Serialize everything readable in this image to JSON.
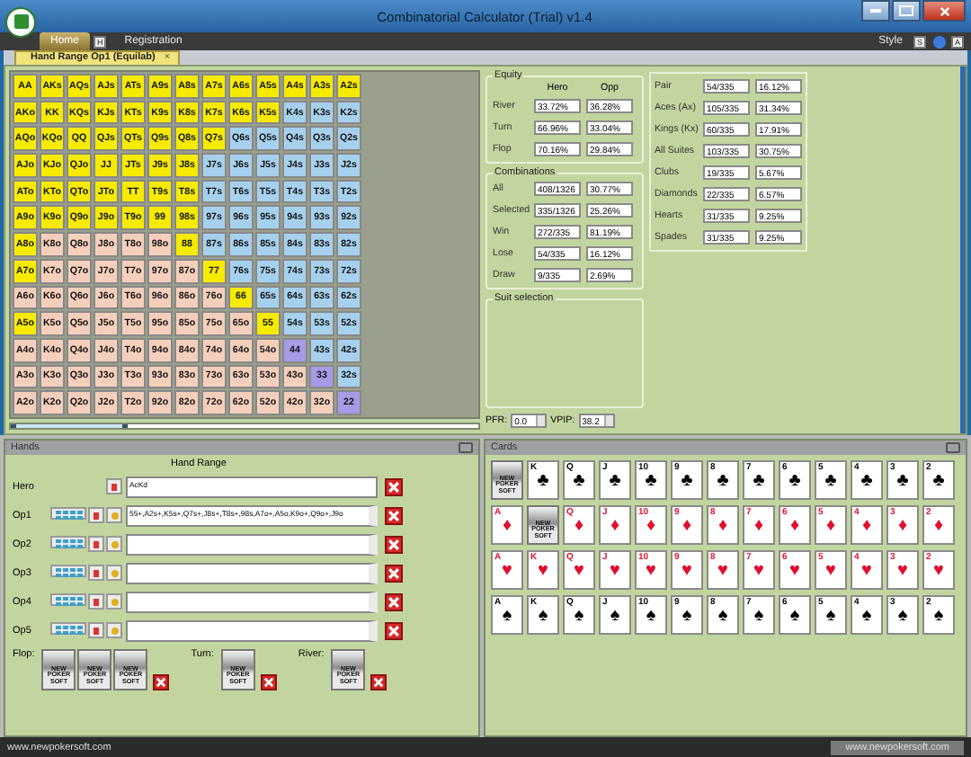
{
  "window": {
    "title": "Combinatorial Calculator (Trial) v1.4"
  },
  "ribbon": {
    "tabs": [
      {
        "label": "Home",
        "selected": true,
        "keytip": "H"
      },
      {
        "label": "Registration",
        "selected": false
      }
    ],
    "style_label": "Style",
    "style_keytip": "S",
    "help_keytip": "A"
  },
  "document_tab": {
    "label": "Hand Range Op1 (Equilab)",
    "close": "×"
  },
  "range_grid": {
    "rows": [
      {
        "cells": [
          {
            "label": "AA",
            "selected": true
          },
          {
            "label": "AKs",
            "selected": true
          },
          {
            "label": "AQs",
            "selected": true
          },
          {
            "label": "AJs",
            "selected": true
          },
          {
            "label": "ATs",
            "selected": true
          },
          {
            "label": "A9s",
            "selected": true
          },
          {
            "label": "A8s",
            "selected": true
          },
          {
            "label": "A7s",
            "selected": true
          },
          {
            "label": "A6s",
            "selected": true
          },
          {
            "label": "A5s",
            "selected": true
          },
          {
            "label": "A4s",
            "selected": true
          },
          {
            "label": "A3s",
            "selected": true
          },
          {
            "label": "A2s",
            "selected": true
          }
        ]
      },
      {
        "cells": [
          {
            "label": "AKo",
            "selected": true
          },
          {
            "label": "KK",
            "selected": true
          },
          {
            "label": "KQs",
            "selected": true
          },
          {
            "label": "KJs",
            "selected": true
          },
          {
            "label": "KTs",
            "selected": true
          },
          {
            "label": "K9s",
            "selected": true
          },
          {
            "label": "K8s",
            "selected": true
          },
          {
            "label": "K7s",
            "selected": true
          },
          {
            "label": "K6s",
            "selected": true
          },
          {
            "label": "K5s",
            "selected": true
          },
          {
            "label": "K4s",
            "selected": false
          },
          {
            "label": "K3s",
            "selected": false
          },
          {
            "label": "K2s",
            "selected": false
          }
        ]
      },
      {
        "cells": [
          {
            "label": "AQo",
            "selected": true
          },
          {
            "label": "KQo",
            "selected": true
          },
          {
            "label": "QQ",
            "selected": true
          },
          {
            "label": "QJs",
            "selected": true
          },
          {
            "label": "QTs",
            "selected": true
          },
          {
            "label": "Q9s",
            "selected": true
          },
          {
            "label": "Q8s",
            "selected": true
          },
          {
            "label": "Q7s",
            "selected": true
          },
          {
            "label": "Q6s",
            "selected": false
          },
          {
            "label": "Q5s",
            "selected": false
          },
          {
            "label": "Q4s",
            "selected": false
          },
          {
            "label": "Q3s",
            "selected": false
          },
          {
            "label": "Q2s",
            "selected": false
          }
        ]
      },
      {
        "cells": [
          {
            "label": "AJo",
            "selected": true
          },
          {
            "label": "KJo",
            "selected": true
          },
          {
            "label": "QJo",
            "selected": true
          },
          {
            "label": "JJ",
            "selected": true
          },
          {
            "label": "JTs",
            "selected": true
          },
          {
            "label": "J9s",
            "selected": true
          },
          {
            "label": "J8s",
            "selected": true
          },
          {
            "label": "J7s",
            "selected": false
          },
          {
            "label": "J6s",
            "selected": false
          },
          {
            "label": "J5s",
            "selected": false
          },
          {
            "label": "J4s",
            "selected": false
          },
          {
            "label": "J3s",
            "selected": false
          },
          {
            "label": "J2s",
            "selected": false
          }
        ]
      },
      {
        "cells": [
          {
            "label": "ATo",
            "selected": true
          },
          {
            "label": "KTo",
            "selected": true
          },
          {
            "label": "QTo",
            "selected": true
          },
          {
            "label": "JTo",
            "selected": true
          },
          {
            "label": "TT",
            "selected": true
          },
          {
            "label": "T9s",
            "selected": true
          },
          {
            "label": "T8s",
            "selected": true
          },
          {
            "label": "T7s",
            "selected": false
          },
          {
            "label": "T6s",
            "selected": false
          },
          {
            "label": "T5s",
            "selected": false
          },
          {
            "label": "T4s",
            "selected": false
          },
          {
            "label": "T3s",
            "selected": false
          },
          {
            "label": "T2s",
            "selected": false
          }
        ]
      },
      {
        "cells": [
          {
            "label": "A9o",
            "selected": true
          },
          {
            "label": "K9o",
            "selected": true
          },
          {
            "label": "Q9o",
            "selected": true
          },
          {
            "label": "J9o",
            "selected": true
          },
          {
            "label": "T9o",
            "selected": true
          },
          {
            "label": "99",
            "selected": true
          },
          {
            "label": "98s",
            "selected": true
          },
          {
            "label": "97s",
            "selected": false
          },
          {
            "label": "96s",
            "selected": false
          },
          {
            "label": "95s",
            "selected": false
          },
          {
            "label": "94s",
            "selected": false
          },
          {
            "label": "93s",
            "selected": false
          },
          {
            "label": "92s",
            "selected": false
          }
        ]
      },
      {
        "cells": [
          {
            "label": "A8o",
            "selected": true
          },
          {
            "label": "K8o",
            "selected": false
          },
          {
            "label": "Q8o",
            "selected": false
          },
          {
            "label": "J8o",
            "selected": false
          },
          {
            "label": "T8o",
            "selected": false
          },
          {
            "label": "98o",
            "selected": false
          },
          {
            "label": "88",
            "selected": true
          },
          {
            "label": "87s",
            "selected": false
          },
          {
            "label": "86s",
            "selected": false
          },
          {
            "label": "85s",
            "selected": false
          },
          {
            "label": "84s",
            "selected": false
          },
          {
            "label": "83s",
            "selected": false
          },
          {
            "label": "82s",
            "selected": false
          }
        ]
      },
      {
        "cells": [
          {
            "label": "A7o",
            "selected": true
          },
          {
            "label": "K7o",
            "selected": false
          },
          {
            "label": "Q7o",
            "selected": false
          },
          {
            "label": "J7o",
            "selected": false
          },
          {
            "label": "T7o",
            "selected": false
          },
          {
            "label": "97o",
            "selected": false
          },
          {
            "label": "87o",
            "selected": false
          },
          {
            "label": "77",
            "selected": true
          },
          {
            "label": "76s",
            "selected": false
          },
          {
            "label": "75s",
            "selected": false
          },
          {
            "label": "74s",
            "selected": false
          },
          {
            "label": "73s",
            "selected": false
          },
          {
            "label": "72s",
            "selected": false
          }
        ]
      },
      {
        "cells": [
          {
            "label": "A6o",
            "selected": false
          },
          {
            "label": "K6o",
            "selected": false
          },
          {
            "label": "Q6o",
            "selected": false
          },
          {
            "label": "J6o",
            "selected": false
          },
          {
            "label": "T6o",
            "selected": false
          },
          {
            "label": "96o",
            "selected": false
          },
          {
            "label": "86o",
            "selected": false
          },
          {
            "label": "76o",
            "selected": false
          },
          {
            "label": "66",
            "selected": true
          },
          {
            "label": "65s",
            "selected": false
          },
          {
            "label": "64s",
            "selected": false
          },
          {
            "label": "63s",
            "selected": false
          },
          {
            "label": "62s",
            "selected": false
          }
        ]
      },
      {
        "cells": [
          {
            "label": "A5o",
            "selected": true
          },
          {
            "label": "K5o",
            "selected": false
          },
          {
            "label": "Q5o",
            "selected": false
          },
          {
            "label": "J5o",
            "selected": false
          },
          {
            "label": "T5o",
            "selected": false
          },
          {
            "label": "95o",
            "selected": false
          },
          {
            "label": "85o",
            "selected": false
          },
          {
            "label": "75o",
            "selected": false
          },
          {
            "label": "65o",
            "selected": false
          },
          {
            "label": "55",
            "selected": true
          },
          {
            "label": "54s",
            "selected": false
          },
          {
            "label": "53s",
            "selected": false
          },
          {
            "label": "52s",
            "selected": false
          }
        ]
      },
      {
        "cells": [
          {
            "label": "A4o",
            "selected": false
          },
          {
            "label": "K4o",
            "selected": false
          },
          {
            "label": "Q4o",
            "selected": false
          },
          {
            "label": "J4o",
            "selected": false
          },
          {
            "label": "T4o",
            "selected": false
          },
          {
            "label": "94o",
            "selected": false
          },
          {
            "label": "84o",
            "selected": false
          },
          {
            "label": "74o",
            "selected": false
          },
          {
            "label": "64o",
            "selected": false
          },
          {
            "label": "54o",
            "selected": false
          },
          {
            "label": "44",
            "selected": false
          },
          {
            "label": "43s",
            "selected": false
          },
          {
            "label": "42s",
            "selected": false
          }
        ]
      },
      {
        "cells": [
          {
            "label": "A3o",
            "selected": false
          },
          {
            "label": "K3o",
            "selected": false
          },
          {
            "label": "Q3o",
            "selected": false
          },
          {
            "label": "J3o",
            "selected": false
          },
          {
            "label": "T3o",
            "selected": false
          },
          {
            "label": "93o",
            "selected": false
          },
          {
            "label": "83o",
            "selected": false
          },
          {
            "label": "73o",
            "selected": false
          },
          {
            "label": "63o",
            "selected": false
          },
          {
            "label": "53o",
            "selected": false
          },
          {
            "label": "43o",
            "selected": false
          },
          {
            "label": "33",
            "selected": false
          },
          {
            "label": "32s",
            "selected": false
          }
        ]
      },
      {
        "cells": [
          {
            "label": "A2o",
            "selected": false
          },
          {
            "label": "K2o",
            "selected": false
          },
          {
            "label": "Q2o",
            "selected": false
          },
          {
            "label": "J2o",
            "selected": false
          },
          {
            "label": "T2o",
            "selected": false
          },
          {
            "label": "92o",
            "selected": false
          },
          {
            "label": "82o",
            "selected": false
          },
          {
            "label": "72o",
            "selected": false
          },
          {
            "label": "62o",
            "selected": false
          },
          {
            "label": "52o",
            "selected": false
          },
          {
            "label": "42o",
            "selected": false
          },
          {
            "label": "32o",
            "selected": false
          },
          {
            "label": "22",
            "selected": false
          }
        ]
      }
    ],
    "range_slider": {
      "level": 0.25
    }
  },
  "equity": {
    "title": "Equity",
    "columns": [
      "Hero",
      "Opp"
    ],
    "rows": [
      {
        "label": "River",
        "hero": "33.72%",
        "opp": "36.28%"
      },
      {
        "label": "Turn",
        "hero": "66.96%",
        "opp": "33.04%"
      },
      {
        "label": "Flop",
        "hero": "70.16%",
        "opp": "29.84%"
      }
    ]
  },
  "combinations": {
    "title": "Combinations",
    "rows": [
      {
        "label": "All",
        "count": "408/1326",
        "percent": "30.77%"
      },
      {
        "label": "Selected",
        "count": "335/1326",
        "percent": "25.26%"
      },
      {
        "label": "Win",
        "count": "272/335",
        "percent": "81.19%"
      },
      {
        "label": "Lose",
        "count": "54/335",
        "percent": "16.12%"
      },
      {
        "label": "Draw",
        "count": "9/335",
        "percent": "2.69%"
      }
    ]
  },
  "suit_selection": {
    "title": "Suit selection"
  },
  "pfr": {
    "label": "PFR:",
    "value": "0.0"
  },
  "vpip": {
    "label": "VPIP:",
    "value": "38.2"
  },
  "stats": [
    {
      "label": "Pair",
      "count": "54/335",
      "percent": "16.12%"
    },
    {
      "label": "Aces (Ax)",
      "count": "105/335",
      "percent": "31.34%"
    },
    {
      "label": "Kings (Kx)",
      "count": "60/335",
      "percent": "17.91%"
    },
    {
      "label": "All Suites",
      "count": "103/335",
      "percent": "30.75%"
    },
    {
      "label": "Clubs",
      "count": "19/335",
      "percent": "5.67%"
    },
    {
      "label": "Diamonds",
      "count": "22/335",
      "percent": "6.57%"
    },
    {
      "label": "Hearts",
      "count": "31/335",
      "percent": "9.25%"
    },
    {
      "label": "Spades",
      "count": "31/335",
      "percent": "9.25%"
    }
  ],
  "hands_panel": {
    "title": "Hands",
    "range_header": "Hand Range",
    "rows": [
      {
        "label": "Hero",
        "kind": "hero",
        "value": "AcKd"
      },
      {
        "label": "Op1",
        "kind": "opponent",
        "value": "55+,A2s+,K5s+,Q7s+,J8s+,T8s+,98s,A7o+,A5o,K9o+,Q9o+,J9o"
      },
      {
        "label": "Op2",
        "kind": "opponent",
        "value": ""
      },
      {
        "label": "Op3",
        "kind": "opponent",
        "value": ""
      },
      {
        "label": "Op4",
        "kind": "opponent",
        "value": ""
      },
      {
        "label": "Op5",
        "kind": "opponent",
        "value": ""
      }
    ],
    "board": [
      {
        "label": "Flop:",
        "slots": [
          {
            "back_label": "NEW POKER SOFT"
          },
          {
            "back_label": "NEW POKER SOFT"
          },
          {
            "back_label": "NEW POKER SOFT"
          }
        ]
      },
      {
        "label": "Turn:",
        "slots": [
          {
            "back_label": "NEW POKER SOFT"
          }
        ]
      },
      {
        "label": "River:",
        "slots": [
          {
            "back_label": "NEW POKER SOFT"
          }
        ]
      }
    ]
  },
  "cards_panel": {
    "title": "Cards",
    "suits": [
      {
        "suit": "♣",
        "color": "#000000",
        "cards": [
          {
            "kind": "back",
            "back_label": "NEW POKER SOFT"
          },
          {
            "kind": "face",
            "rank": "K"
          },
          {
            "kind": "face",
            "rank": "Q"
          },
          {
            "kind": "face",
            "rank": "J"
          },
          {
            "kind": "face",
            "rank": "10"
          },
          {
            "kind": "face",
            "rank": "9"
          },
          {
            "kind": "face",
            "rank": "8"
          },
          {
            "kind": "face",
            "rank": "7"
          },
          {
            "kind": "face",
            "rank": "6"
          },
          {
            "kind": "face",
            "rank": "5"
          },
          {
            "kind": "face",
            "rank": "4"
          },
          {
            "kind": "face",
            "rank": "3"
          },
          {
            "kind": "face",
            "rank": "2"
          }
        ]
      },
      {
        "suit": "♦",
        "color": "#e0102e",
        "cards": [
          {
            "kind": "face",
            "rank": "A"
          },
          {
            "kind": "back",
            "back_label": "NEW POKER SOFT"
          },
          {
            "kind": "face",
            "rank": "Q"
          },
          {
            "kind": "face",
            "rank": "J"
          },
          {
            "kind": "face",
            "rank": "10"
          },
          {
            "kind": "face",
            "rank": "9"
          },
          {
            "kind": "face",
            "rank": "8"
          },
          {
            "kind": "face",
            "rank": "7"
          },
          {
            "kind": "face",
            "rank": "6"
          },
          {
            "kind": "face",
            "rank": "5"
          },
          {
            "kind": "face",
            "rank": "4"
          },
          {
            "kind": "face",
            "rank": "3"
          },
          {
            "kind": "face",
            "rank": "2"
          }
        ]
      },
      {
        "suit": "♥",
        "color": "#e0102e",
        "cards": [
          {
            "kind": "face",
            "rank": "A"
          },
          {
            "kind": "face",
            "rank": "K"
          },
          {
            "kind": "face",
            "rank": "Q"
          },
          {
            "kind": "face",
            "rank": "J"
          },
          {
            "kind": "face",
            "rank": "10"
          },
          {
            "kind": "face",
            "rank": "9"
          },
          {
            "kind": "face",
            "rank": "8"
          },
          {
            "kind": "face",
            "rank": "7"
          },
          {
            "kind": "face",
            "rank": "6"
          },
          {
            "kind": "face",
            "rank": "5"
          },
          {
            "kind": "face",
            "rank": "4"
          },
          {
            "kind": "face",
            "rank": "3"
          },
          {
            "kind": "face",
            "rank": "2"
          }
        ]
      },
      {
        "suit": "♠",
        "color": "#000000",
        "cards": [
          {
            "kind": "face",
            "rank": "A"
          },
          {
            "kind": "face",
            "rank": "K"
          },
          {
            "kind": "face",
            "rank": "Q"
          },
          {
            "kind": "face",
            "rank": "J"
          },
          {
            "kind": "face",
            "rank": "10"
          },
          {
            "kind": "face",
            "rank": "9"
          },
          {
            "kind": "face",
            "rank": "8"
          },
          {
            "kind": "face",
            "rank": "7"
          },
          {
            "kind": "face",
            "rank": "6"
          },
          {
            "kind": "face",
            "rank": "5"
          },
          {
            "kind": "face",
            "rank": "4"
          },
          {
            "kind": "face",
            "rank": "3"
          },
          {
            "kind": "face",
            "rank": "2"
          }
        ]
      }
    ]
  },
  "status_bar": {
    "left": "www.newpokersoft.com",
    "right": "www.newpokersoft.com"
  }
}
